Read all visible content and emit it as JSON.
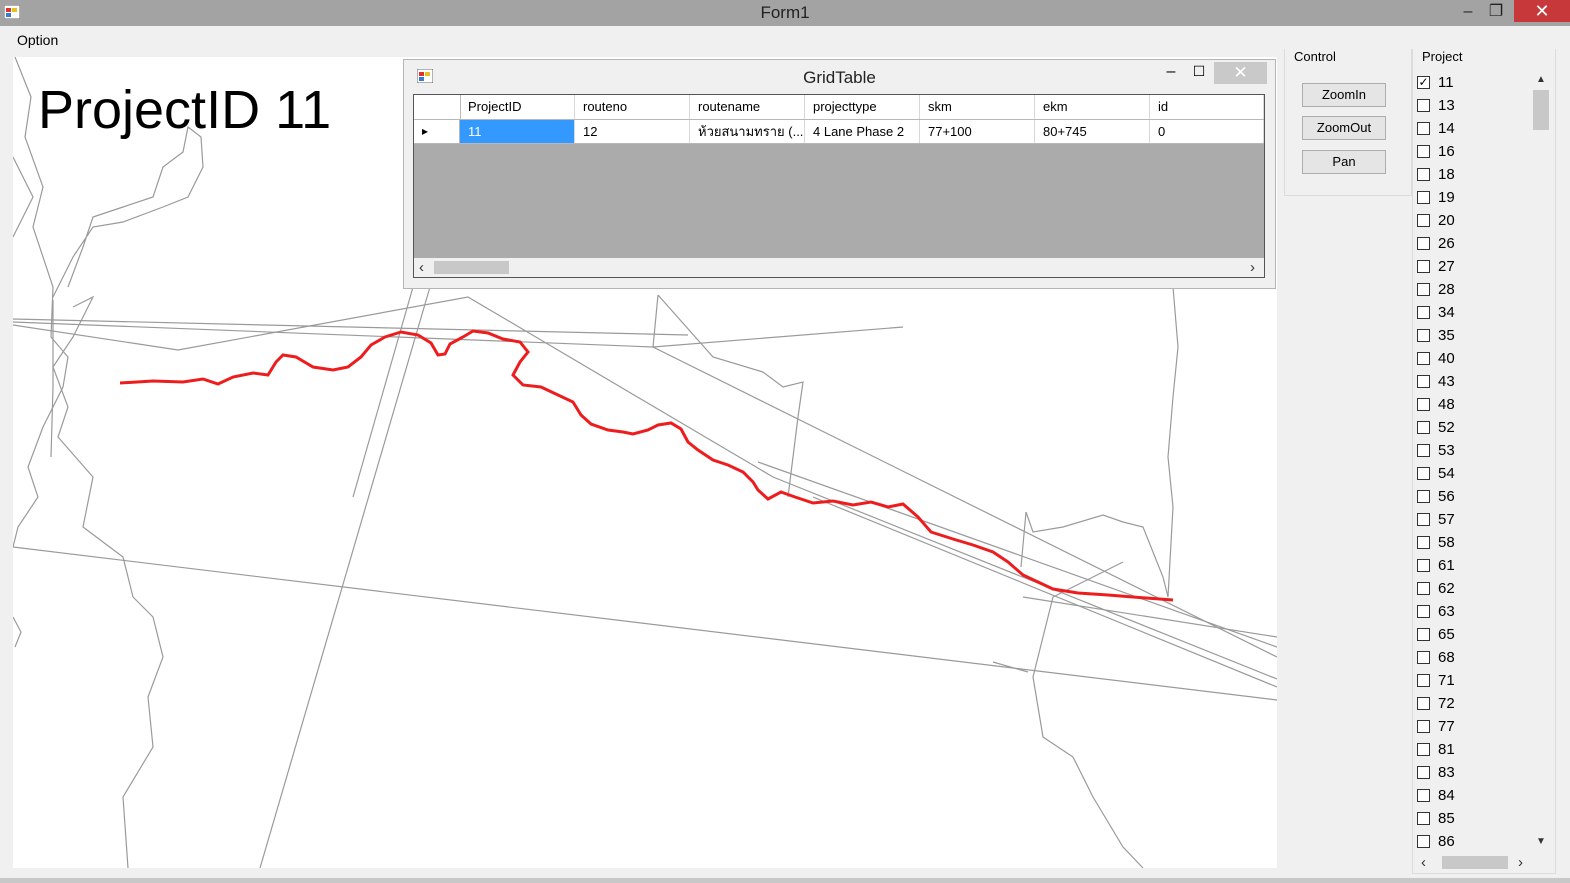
{
  "window": {
    "title": "Form1",
    "minimize": "–",
    "restore": "❐",
    "close": "✕"
  },
  "menu": {
    "option": "Option"
  },
  "map": {
    "project_label": "ProjectID 11",
    "highlight_color": "#ee1c1c",
    "line_color": "#9a9a9a"
  },
  "gridtable": {
    "title": "GridTable",
    "minimize": "–",
    "maximize": "☐",
    "close": "✕",
    "columns": [
      "ProjectID",
      "routeno",
      "routename",
      "projecttype",
      "skm",
      "ekm",
      "id"
    ],
    "row": {
      "pointer": "▸",
      "cells": [
        "11",
        "12",
        "ห้วยสนามทราย (...",
        "4 Lane Phase 2",
        "77+100",
        "80+745",
        "0"
      ]
    },
    "scroll_left": "‹",
    "scroll_right": "›"
  },
  "control": {
    "label": "Control",
    "zoom_in": "ZoomIn",
    "zoom_out": "ZoomOut",
    "pan": "Pan"
  },
  "project": {
    "label": "Project",
    "items": [
      {
        "id": "11",
        "checked": true
      },
      {
        "id": "13",
        "checked": false
      },
      {
        "id": "14",
        "checked": false
      },
      {
        "id": "16",
        "checked": false
      },
      {
        "id": "18",
        "checked": false
      },
      {
        "id": "19",
        "checked": false
      },
      {
        "id": "20",
        "checked": false
      },
      {
        "id": "26",
        "checked": false
      },
      {
        "id": "27",
        "checked": false
      },
      {
        "id": "28",
        "checked": false
      },
      {
        "id": "34",
        "checked": false
      },
      {
        "id": "35",
        "checked": false
      },
      {
        "id": "40",
        "checked": false
      },
      {
        "id": "43",
        "checked": false
      },
      {
        "id": "48",
        "checked": false
      },
      {
        "id": "52",
        "checked": false
      },
      {
        "id": "53",
        "checked": false
      },
      {
        "id": "54",
        "checked": false
      },
      {
        "id": "56",
        "checked": false
      },
      {
        "id": "57",
        "checked": false
      },
      {
        "id": "58",
        "checked": false
      },
      {
        "id": "61",
        "checked": false
      },
      {
        "id": "62",
        "checked": false
      },
      {
        "id": "63",
        "checked": false
      },
      {
        "id": "65",
        "checked": false
      },
      {
        "id": "68",
        "checked": false
      },
      {
        "id": "71",
        "checked": false
      },
      {
        "id": "72",
        "checked": false
      },
      {
        "id": "77",
        "checked": false
      },
      {
        "id": "81",
        "checked": false
      },
      {
        "id": "83",
        "checked": false
      },
      {
        "id": "84",
        "checked": false
      },
      {
        "id": "85",
        "checked": false
      },
      {
        "id": "86",
        "checked": false
      }
    ],
    "scroll_up": "▲",
    "scroll_down": "▼",
    "scroll_left": "‹",
    "scroll_right": "›"
  }
}
